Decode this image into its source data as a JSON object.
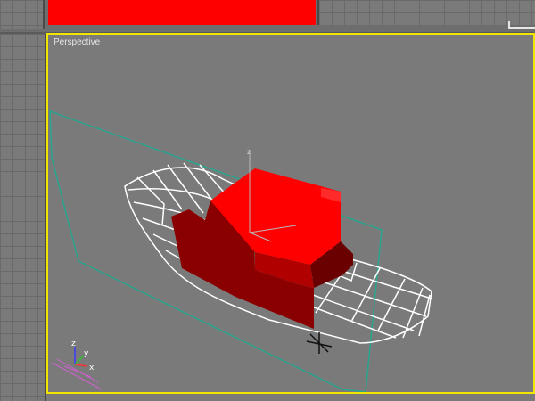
{
  "viewports": {
    "perspective": {
      "label": "Perspective"
    },
    "active_border_color": "#f2e600"
  },
  "scene": {
    "object_color": "#ff0000",
    "wireframe_color": "#ffffff",
    "grid_outline_color": "#2aa58e"
  },
  "axis_gizmo": {
    "x": "x",
    "y": "y",
    "z": "z"
  },
  "icons": [
    "axis-tripod-icon",
    "pivot-cross-icon"
  ]
}
